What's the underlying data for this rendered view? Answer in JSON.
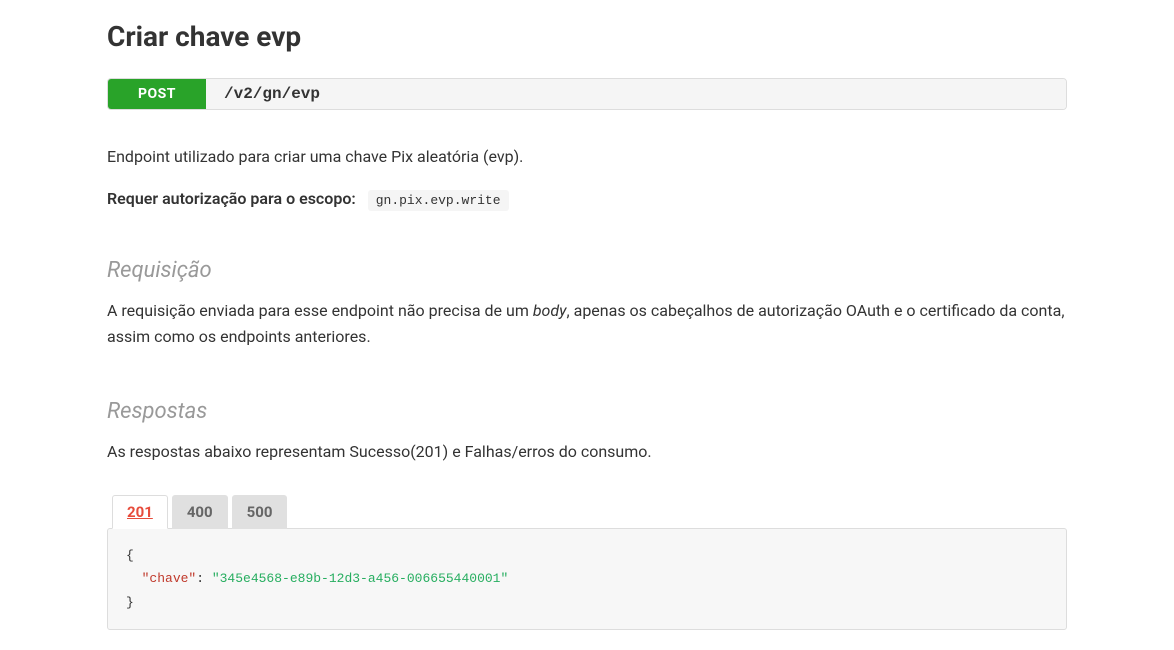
{
  "page": {
    "title": "Criar chave evp"
  },
  "endpoint": {
    "method": "POST",
    "path": "/v2/gn/evp"
  },
  "description": "Endpoint utilizado para criar uma chave Pix aleatória (evp).",
  "auth": {
    "label": "Requer autorização para o escopo:",
    "scope": "gn.pix.evp.write"
  },
  "sections": {
    "request": {
      "title": "Requisição",
      "text_before": "A requisição enviada para esse endpoint não precisa de um ",
      "text_em": "body",
      "text_after": ", apenas os cabeçalhos de autorização OAuth e o certificado da conta, assim como os endpoints anteriores."
    },
    "responses": {
      "title": "Respostas",
      "text": "As respostas abaixo representam Sucesso(201) e Falhas/erros do consumo."
    }
  },
  "tabs": {
    "t0": "201",
    "t1": "400",
    "t2": "500"
  },
  "code": {
    "open": "{",
    "key": "\"chave\"",
    "colon": ": ",
    "value": "\"345e4568-e89b-12d3-a456-006655440001\"",
    "close": "}"
  }
}
